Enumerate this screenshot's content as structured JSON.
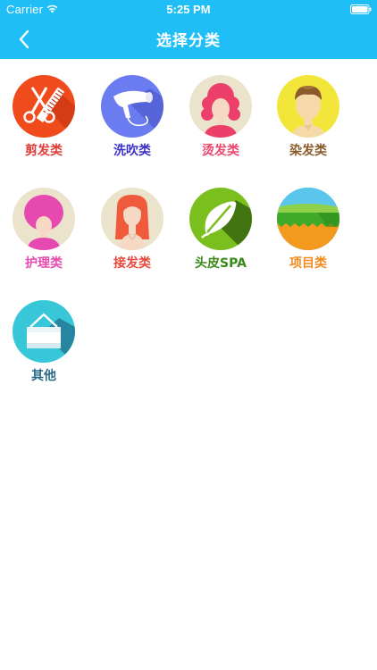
{
  "status_bar": {
    "carrier": "Carrier",
    "time": "5:25 PM",
    "icons": [
      "wifi-icon",
      "battery-icon"
    ]
  },
  "nav": {
    "back_icon": "chevron-left-icon",
    "title": "选择分类",
    "bg_color": "#1fbef7"
  },
  "categories": [
    {
      "label": "剪发类",
      "icon": "scissors-comb-icon",
      "color": "#e23a36"
    },
    {
      "label": "洗吹类",
      "icon": "hair-dryer-icon",
      "color": "#3b31c9"
    },
    {
      "label": "烫发类",
      "icon": "curly-hair-woman-icon",
      "color": "#e9486e"
    },
    {
      "label": "染发类",
      "icon": "dyed-hair-man-icon",
      "color": "#8b5a2b"
    },
    {
      "label": "护理类",
      "icon": "hair-care-icon",
      "color": "#e64ab0"
    },
    {
      "label": "接发类",
      "icon": "hair-extension-icon",
      "color": "#e9483f"
    },
    {
      "label": "头皮SPA",
      "icon": "leaf-icon",
      "color": "#3a8a1a"
    },
    {
      "label": "项目类",
      "icon": "landscape-project-icon",
      "color": "#f28a1d"
    },
    {
      "label": "其他",
      "icon": "towel-icon",
      "color": "#2b6a86"
    }
  ]
}
